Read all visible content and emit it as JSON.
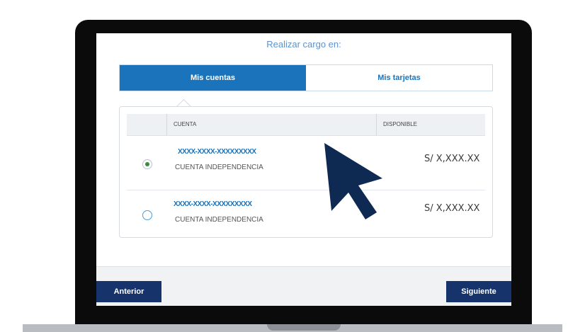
{
  "heading": "Realizar cargo en:",
  "tabs": [
    {
      "label": "Mis cuentas",
      "active": true
    },
    {
      "label": "Mis tarjetas",
      "active": false
    }
  ],
  "table": {
    "headers": [
      "CUENTA",
      "DISPONIBLE"
    ],
    "rows": [
      {
        "number": "XXXX-XXXX-XXXXXXXXX",
        "type": "CUENTA INDEPENDENCIA",
        "balance": "S/ X,XXX.XX",
        "selected": true
      },
      {
        "number": "XXXX-XXXX-XXXXXXXXX",
        "type": "CUENTA INDEPENDENCIA",
        "balance": "S/ X,XXX.XX",
        "selected": false
      }
    ]
  },
  "footer": {
    "back_label": "Anterior",
    "next_label": "Siguiente"
  },
  "colors": {
    "accent": "#1b74bb",
    "button": "#16336b",
    "selected_radio": "#3a8a3a"
  },
  "icons": [
    "mouse-pointer-icon",
    "radio-selected-icon",
    "radio-unselected-icon"
  ]
}
